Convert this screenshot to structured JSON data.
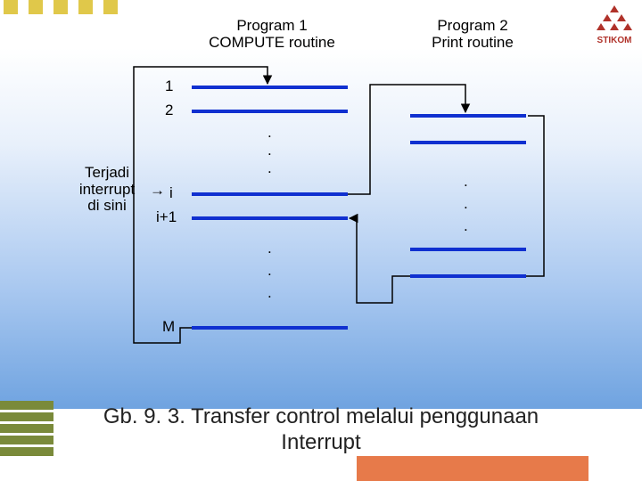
{
  "decor": {
    "logo_text": "STIKOM"
  },
  "diagram": {
    "program1": {
      "title_line1": "Program 1",
      "title_line2": "COMPUTE routine"
    },
    "program2": {
      "title_line1": "Program 2",
      "title_line2": "Print routine"
    },
    "row_labels": {
      "r1": "1",
      "r2": "2",
      "ri": "i",
      "rip1": "i+1",
      "rm": "M"
    },
    "interrupt": {
      "line1": "Terjadi",
      "line2": "interrupt",
      "line3": "di sini",
      "arrow": "→"
    },
    "ellipsis": "."
  },
  "caption": {
    "line1": "Gb. 9. 3. Transfer control melalui penggunaan",
    "line2": "Interrupt"
  }
}
